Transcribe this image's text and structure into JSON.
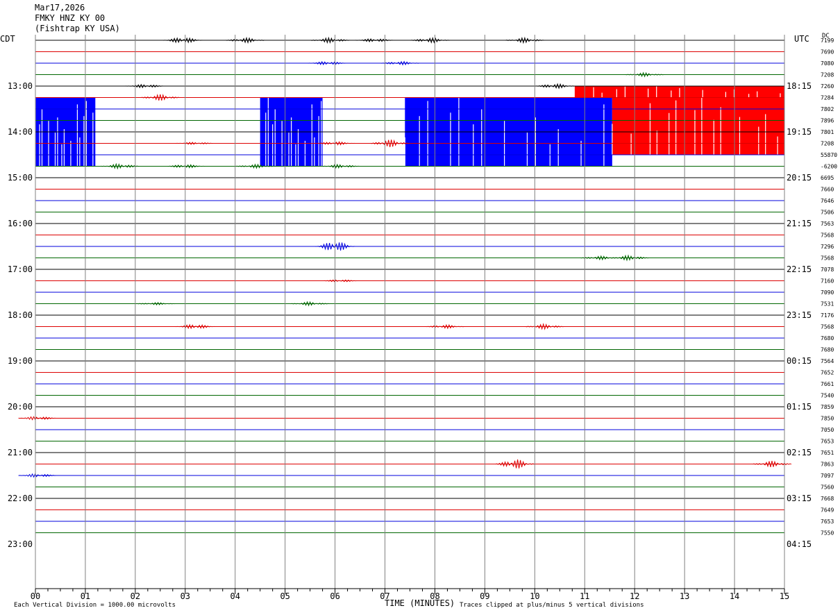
{
  "header": {
    "date": "Mar17,2026",
    "station": "FMKY HNZ KY 00",
    "location": "(Fishtrap KY USA)"
  },
  "labels": {
    "left_tz": "CDT",
    "right_tz": "UTC",
    "dc": "DC",
    "x_axis_title": "TIME (MINUTES)",
    "scale_note": "Each Vertical Division = 1000.00 microvolts",
    "clip_note": "Traces clipped at plus/minus 5 vertical divisions"
  },
  "colors": {
    "trace_cycle": [
      "#000000",
      "#dd0000",
      "#0000dd",
      "#006600"
    ],
    "vertical_grid": "#808080",
    "clipped_blue": "#0000ff",
    "clipped_red": "#ff0000"
  },
  "chart_data": {
    "type": "line",
    "title": "FMKY HNZ KY 00",
    "xlabel": "TIME (MINUTES)",
    "ylabel": "",
    "x_ticks": [
      "00",
      "01",
      "02",
      "03",
      "04",
      "05",
      "06",
      "07",
      "08",
      "09",
      "10",
      "11",
      "12",
      "13",
      "14",
      "15"
    ],
    "xlim": [
      0,
      15
    ],
    "trace_interval_minutes": 15,
    "trace_count": 44,
    "left_hour_labels": [
      "13:00",
      "14:00",
      "15:00",
      "16:00",
      "17:00",
      "18:00",
      "19:00",
      "20:00",
      "21:00",
      "22:00",
      "23:00"
    ],
    "right_hour_labels": [
      "18:15",
      "19:15",
      "20:15",
      "21:15",
      "22:15",
      "23:15",
      "00:15",
      "01:15",
      "02:15",
      "03:15",
      "04:15"
    ],
    "first_hour_label_trace": 4,
    "dc_offsets": [
      "7199",
      "7690",
      "7080",
      "7208",
      "7260",
      "7284",
      "7802",
      "7896",
      "7801",
      "7208",
      "55870",
      "-6200",
      "6695",
      "7660",
      "7646",
      "7506",
      "7563",
      "7568",
      "7296",
      "7568",
      "7078",
      "7160",
      "7090",
      "7531",
      "7176",
      "7568",
      "7680",
      "7680",
      "7564",
      "7652",
      "7661",
      "7540",
      "7859",
      "7850",
      "7050",
      "7653",
      "7651",
      "7863",
      "7097",
      "7560",
      "7668",
      "7649",
      "7653",
      "7550"
    ],
    "clipped_blocks": [
      {
        "series": "blue",
        "start_trace": 5,
        "end_trace": 10,
        "x_start_min": 0.0,
        "x_end_min": 1.2
      },
      {
        "series": "blue",
        "start_trace": 5,
        "end_trace": 10,
        "x_start_min": 4.5,
        "x_end_min": 5.75
      },
      {
        "series": "blue",
        "start_trace": 5,
        "end_trace": 10,
        "x_start_min": 7.4,
        "x_end_min": 11.55
      },
      {
        "series": "red",
        "start_trace": 4,
        "end_trace": 4,
        "x_start_min": 10.8,
        "x_end_min": 15.0
      },
      {
        "series": "red",
        "start_trace": 5,
        "end_trace": 9,
        "x_start_min": 11.55,
        "x_end_min": 15.0
      }
    ],
    "events": [
      {
        "trace": 0,
        "minute": 2.95,
        "amp": 0.5
      },
      {
        "trace": 0,
        "minute": 4.2,
        "amp": 0.4
      },
      {
        "trace": 0,
        "minute": 5.9,
        "amp": 0.4
      },
      {
        "trace": 0,
        "minute": 6.8,
        "amp": 0.3
      },
      {
        "trace": 0,
        "minute": 7.9,
        "amp": 0.4
      },
      {
        "trace": 0,
        "minute": 9.8,
        "amp": 0.4
      },
      {
        "trace": 2,
        "minute": 5.85,
        "amp": 0.3
      },
      {
        "trace": 2,
        "minute": 7.3,
        "amp": 0.3
      },
      {
        "trace": 3,
        "minute": 12.2,
        "amp": 0.3
      },
      {
        "trace": 4,
        "minute": 2.2,
        "amp": 0.3
      },
      {
        "trace": 4,
        "minute": 10.4,
        "amp": 0.4
      },
      {
        "trace": 5,
        "minute": 2.5,
        "amp": 0.5
      },
      {
        "trace": 9,
        "minute": 3.2,
        "amp": 0.2
      },
      {
        "trace": 9,
        "minute": 6.0,
        "amp": 0.3
      },
      {
        "trace": 9,
        "minute": 7.1,
        "amp": 0.6
      },
      {
        "trace": 11,
        "minute": 1.7,
        "amp": 0.4
      },
      {
        "trace": 11,
        "minute": 3.0,
        "amp": 0.3
      },
      {
        "trace": 11,
        "minute": 4.4,
        "amp": 0.3
      },
      {
        "trace": 11,
        "minute": 6.1,
        "amp": 0.3
      },
      {
        "trace": 18,
        "minute": 6.0,
        "amp": 0.9
      },
      {
        "trace": 19,
        "minute": 11.3,
        "amp": 0.3
      },
      {
        "trace": 19,
        "minute": 11.9,
        "amp": 0.4
      },
      {
        "trace": 21,
        "minute": 6.1,
        "amp": 0.2
      },
      {
        "trace": 23,
        "minute": 2.4,
        "amp": 0.2
      },
      {
        "trace": 23,
        "minute": 5.5,
        "amp": 0.3
      },
      {
        "trace": 25,
        "minute": 3.2,
        "amp": 0.4
      },
      {
        "trace": 25,
        "minute": 8.2,
        "amp": 0.3
      },
      {
        "trace": 25,
        "minute": 10.2,
        "amp": 0.4
      },
      {
        "trace": 33,
        "minute": 0.05,
        "amp": 0.3
      },
      {
        "trace": 37,
        "minute": 9.6,
        "amp": 0.8
      },
      {
        "trace": 37,
        "minute": 14.75,
        "amp": 0.5
      },
      {
        "trace": 38,
        "minute": 0.05,
        "amp": 0.3
      }
    ]
  }
}
